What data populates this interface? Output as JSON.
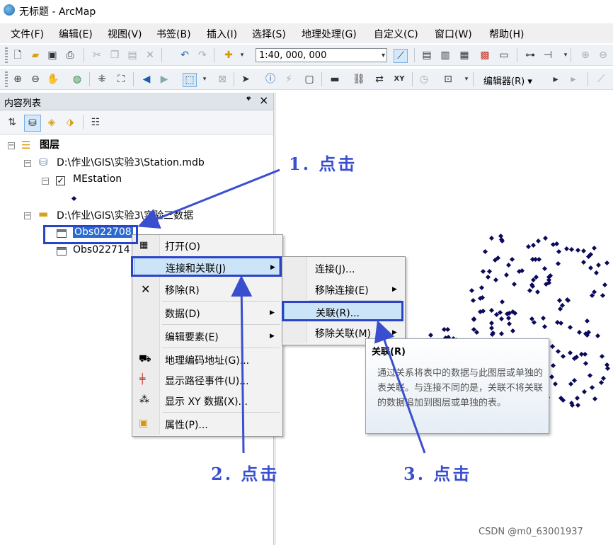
{
  "window": {
    "title": "无标题 - ArcMap"
  },
  "menubar": [
    "文件(F)",
    "编辑(E)",
    "视图(V)",
    "书签(B)",
    "插入(I)",
    "选择(S)",
    "地理处理(G)",
    "自定义(C)",
    "窗口(W)",
    "帮助(H)"
  ],
  "toolbar": {
    "scale": "1:40, 000, 000",
    "editor_label": "编辑器(R)"
  },
  "toc": {
    "title": "内容列表",
    "pin": "ᵖ",
    "close": "×",
    "root": "图层",
    "db_path": "D:\\作业\\GIS\\实验3\\Station.mdb",
    "db_layer": "MEstation",
    "folder_path": "D:\\作业\\GIS\\实验3\\实验三数据",
    "table1": "Obs022708",
    "table2": "Obs022714"
  },
  "context_menu": {
    "items": [
      "打开(O)",
      "连接和关联(J)",
      "移除(R)",
      "数据(D)",
      "编辑要素(E)",
      "地理编码地址(G)...",
      "显示路径事件(U)...",
      "显示 XY 数据(X)...",
      "属性(P)..."
    ]
  },
  "submenu": {
    "items": [
      "连接(J)...",
      "移除连接(E)",
      "关联(R)...",
      "移除关联(M)"
    ]
  },
  "tooltip": {
    "title": "关联(R)",
    "body": "通过关系将表中的数据与此图层或单独的表关联。与连接不同的是，关联不将关联的数据追加到图层或单独的表。"
  },
  "annotations": {
    "step1": "1. 点击",
    "step2": "2. 点击",
    "step3": "3. 点击"
  },
  "watermark": "CSDN @m0_63001937",
  "colors": {
    "annotation": "#2a44c8",
    "highlight": "#cce4f7",
    "points": "#0a0a5a"
  }
}
